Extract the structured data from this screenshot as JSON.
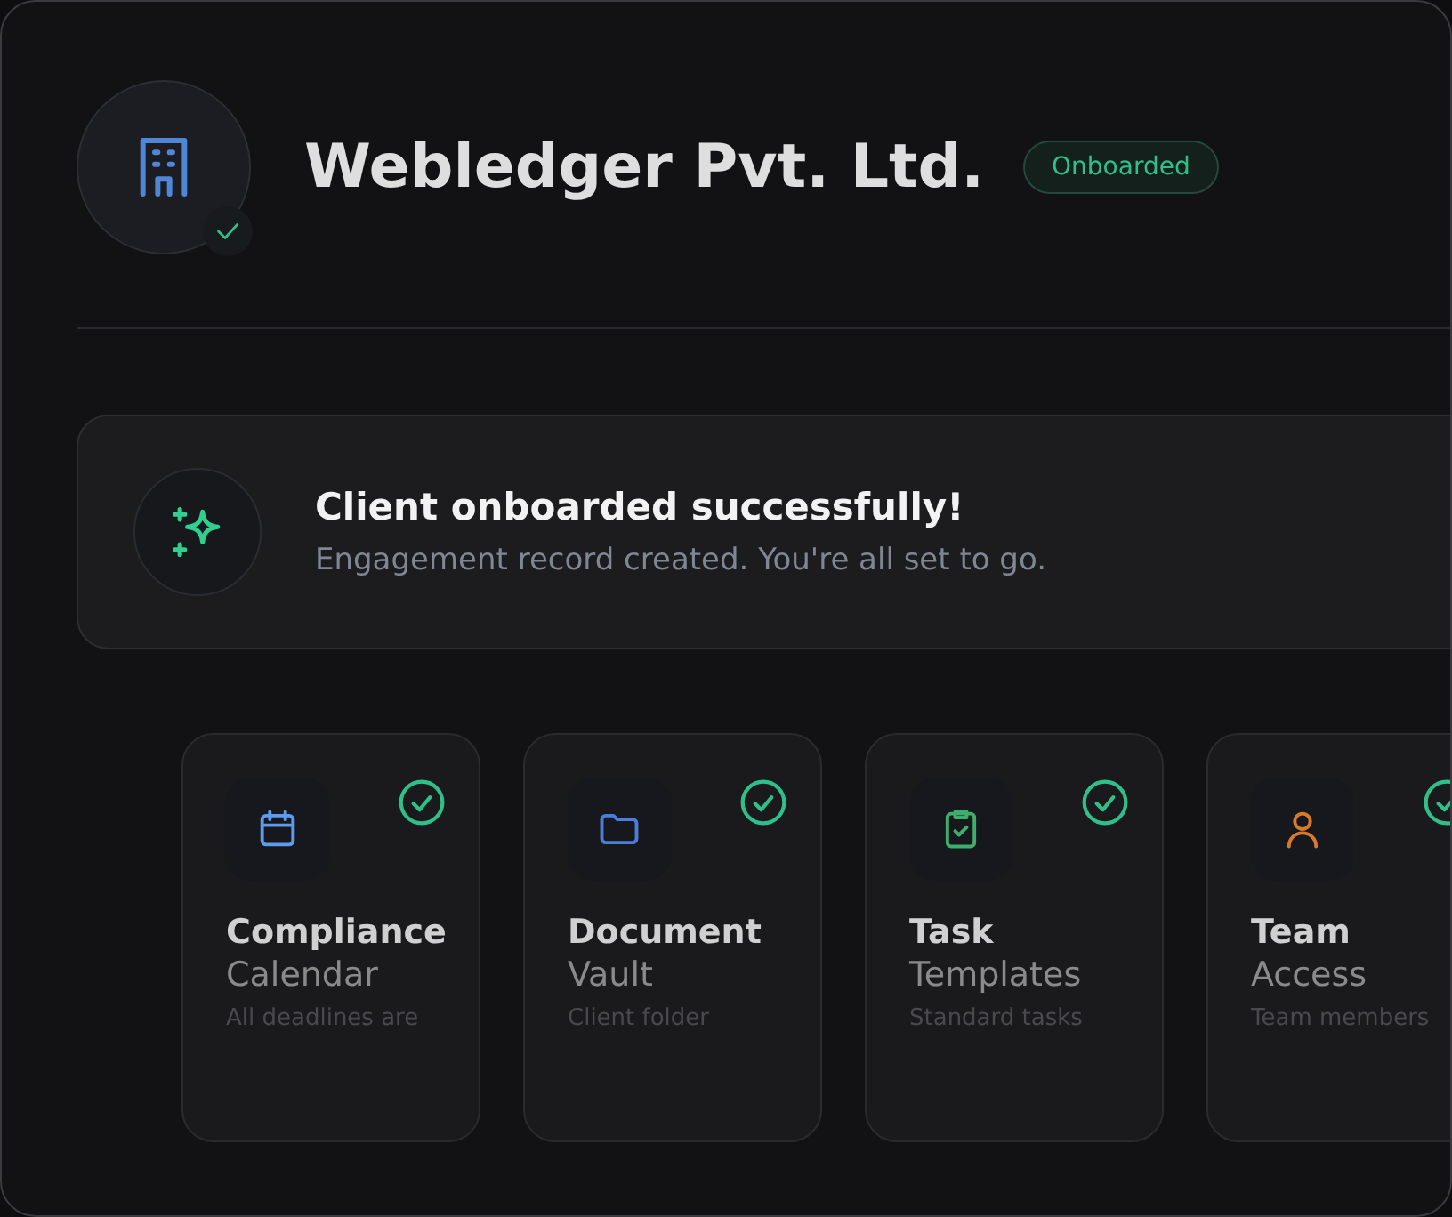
{
  "company": {
    "name": "Webledger Pvt. Ltd.",
    "verified": true,
    "badge": "Onboarded"
  },
  "banner": {
    "title": "Client onboarded successfully!",
    "subtitle": "Engagement record created. You're all set to go."
  },
  "modules": [
    {
      "kind": "calendar",
      "title": "Compliance",
      "subtitle": "Calendar",
      "description": "All deadlines are",
      "color": "#5b9bf0",
      "done": true
    },
    {
      "kind": "folder",
      "title": "Document",
      "subtitle": "Vault",
      "description": "Client folder",
      "color": "#4a7fd9",
      "done": true
    },
    {
      "kind": "clipboard",
      "title": "Task",
      "subtitle": "Templates",
      "description": "Standard tasks",
      "color": "#3fae6a",
      "done": true
    },
    {
      "kind": "person",
      "title": "Team",
      "subtitle": "Access",
      "description": "Team members",
      "color": "#d97a2b",
      "done": true
    }
  ]
}
